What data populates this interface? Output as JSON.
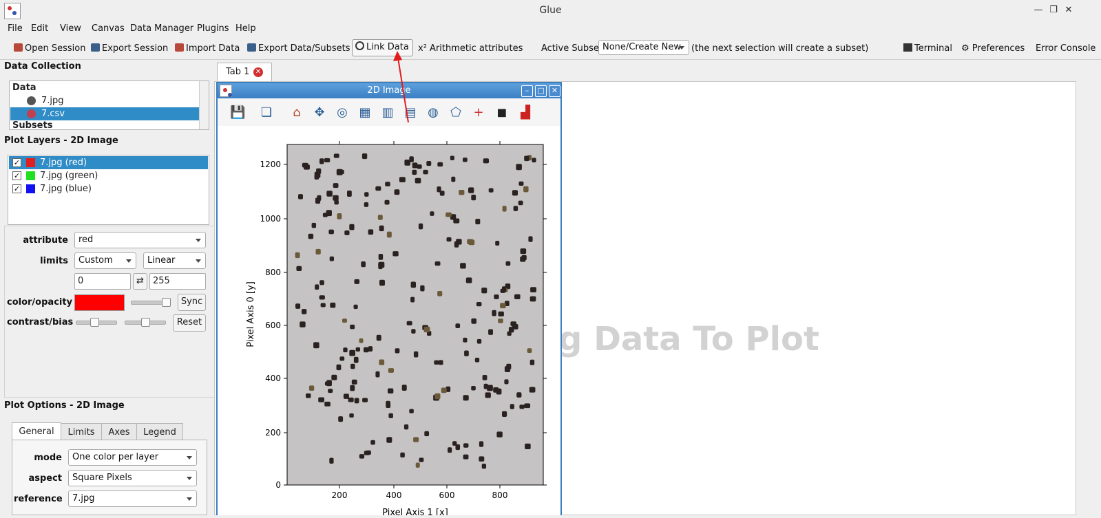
{
  "window": {
    "title": "Glue"
  },
  "menu": [
    "File",
    "Edit",
    "View",
    "Canvas",
    "Data Manager",
    "Plugins",
    "Help"
  ],
  "toolbar": {
    "open_session": "Open Session",
    "export_session": "Export Session",
    "import_data": "Import Data",
    "export_data": "Export Data/Subsets",
    "link_data": "Link Data",
    "arith_prefix": "x²",
    "arith": "Arithmetic attributes",
    "active_subset_label": "Active Subset:",
    "active_subset_value": "None/Create New",
    "subset_hint": "(the next selection will create a subset)",
    "terminal": "Terminal",
    "preferences": "Preferences",
    "error_console": "Error Console"
  },
  "data_collection": {
    "title": "Data Collection",
    "header_data": "Data",
    "items": [
      {
        "label": "7.jpg",
        "color": "#555555",
        "selected": false
      },
      {
        "label": "7.csv",
        "color": "#c0404f",
        "selected": true
      }
    ],
    "header_subsets": "Subsets"
  },
  "plot_layers": {
    "title": "Plot Layers - 2D Image",
    "layers": [
      {
        "label": "7.jpg (red)",
        "color": "#e02020",
        "checked": true,
        "selected": true
      },
      {
        "label": "7.jpg (green)",
        "color": "#20e020",
        "checked": true,
        "selected": false
      },
      {
        "label": "7.jpg (blue)",
        "color": "#1010f0",
        "checked": true,
        "selected": false
      }
    ]
  },
  "layer_props": {
    "attribute_label": "attribute",
    "attribute_value": "red",
    "limits_label": "limits",
    "limits_mode": "Custom",
    "limits_scale": "Linear",
    "limit_min": "0",
    "limit_max": "255",
    "swap_icon": "⇄",
    "color_label": "color/opacity",
    "color_value": "#ff0000",
    "opacity": 0.95,
    "sync_label": "Sync",
    "contrast_label": "contrast/bias",
    "contrast": 0.45,
    "bias": 0.5,
    "reset_label": "Reset"
  },
  "plot_options": {
    "title": "Plot Options - 2D Image",
    "tabs": [
      "General",
      "Limits",
      "Axes",
      "Legend"
    ],
    "active_tab": "General",
    "mode_label": "mode",
    "mode_value": "One color per layer",
    "aspect_label": "aspect",
    "aspect_value": "Square Pixels",
    "reference_label": "reference",
    "reference_value": "7.jpg"
  },
  "tabs": [
    {
      "label": "Tab 1"
    }
  ],
  "canvas_watermark": "g Data To Plot",
  "subwindow": {
    "title": "2D Image",
    "ylabel": "Pixel Axis 0 [y]",
    "xlabel": "Pixel Axis 1 [x]",
    "yticks": [
      "1200",
      "1000",
      "800",
      "600",
      "400",
      "200",
      "0"
    ],
    "xticks": [
      "200",
      "400",
      "600",
      "800"
    ],
    "image_bg": "#c6c3c4"
  }
}
